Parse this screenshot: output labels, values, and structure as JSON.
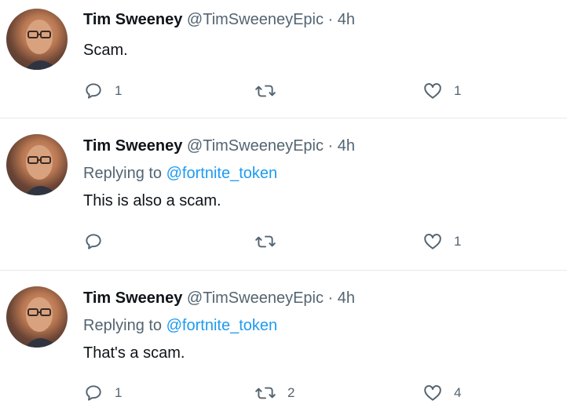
{
  "tweets": [
    {
      "name": "Tim Sweeney",
      "handle": "@TimSweeneyEpic",
      "separator": "·",
      "time": "4h",
      "replying_label": "",
      "replying_to": "",
      "text": "Scam.",
      "reply_count": "1",
      "retweet_count": "",
      "like_count": "1"
    },
    {
      "name": "Tim Sweeney",
      "handle": "@TimSweeneyEpic",
      "separator": "·",
      "time": "4h",
      "replying_label": "Replying to",
      "replying_to": "@fortnite_token",
      "text": "This is also a scam.",
      "reply_count": "",
      "retweet_count": "",
      "like_count": "1"
    },
    {
      "name": "Tim Sweeney",
      "handle": "@TimSweeneyEpic",
      "separator": "·",
      "time": "4h",
      "replying_label": "Replying to",
      "replying_to": "@fortnite_token",
      "text": "That's a scam.",
      "reply_count": "1",
      "retweet_count": "2",
      "like_count": "4"
    }
  ],
  "icons": {
    "reply": "reply-icon",
    "retweet": "retweet-icon",
    "like": "like-icon"
  },
  "colors": {
    "text": "#0f1419",
    "secondary": "#536471",
    "link": "#1d9bf0",
    "divider": "#e6e9ec"
  }
}
